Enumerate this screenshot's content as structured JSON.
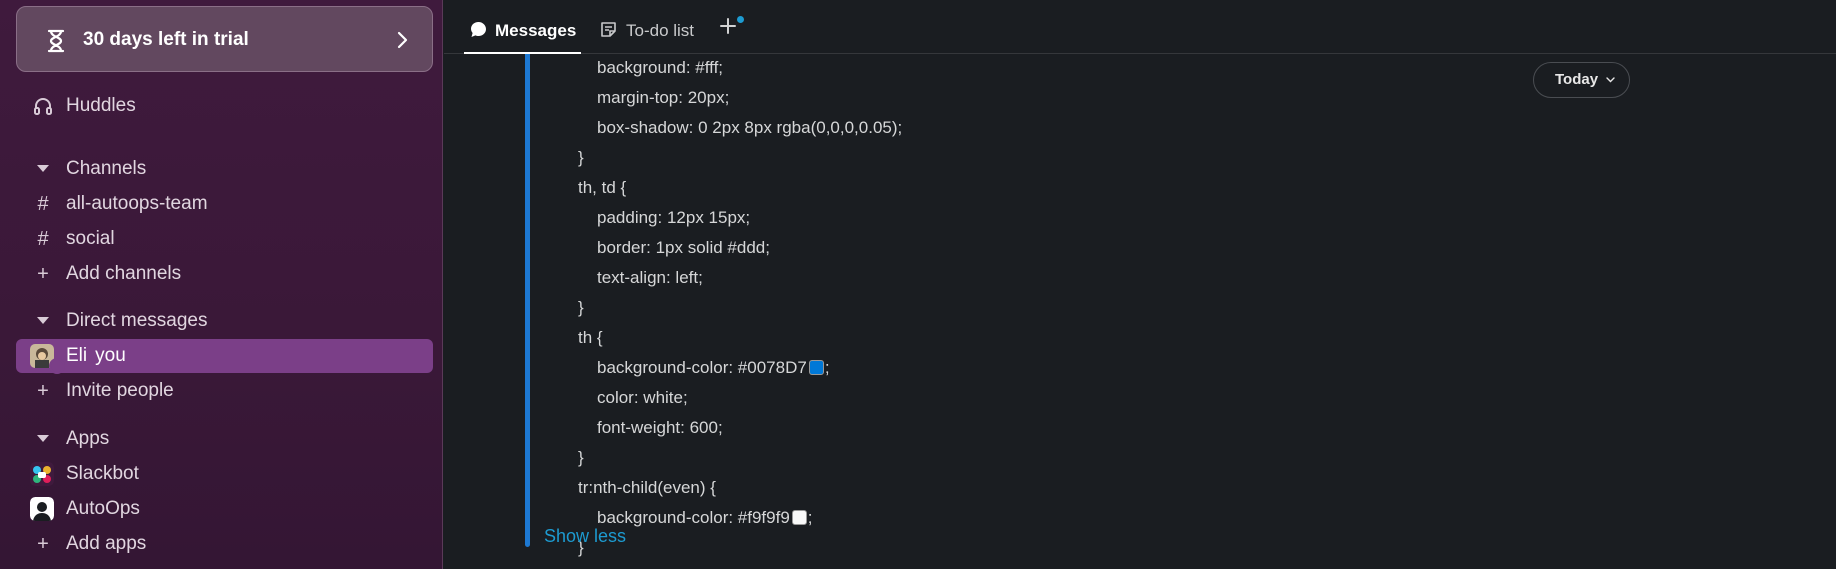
{
  "sidebar": {
    "trial_label": "30 days left in trial",
    "huddles_label": "Huddles",
    "channels_header": "Channels",
    "channels": [
      {
        "label": "all-autoops-team"
      },
      {
        "label": "social"
      }
    ],
    "add_channels_label": "Add channels",
    "dm_header": "Direct messages",
    "dm_user": "Eli",
    "dm_you": "you",
    "invite_label": "Invite people",
    "apps_header": "Apps",
    "apps": [
      {
        "label": "Slackbot"
      },
      {
        "label": "AutoOps"
      }
    ],
    "add_apps_label": "Add apps",
    "active_color": "#7b3f88"
  },
  "tabs": {
    "messages": "Messages",
    "todo": "To-do list"
  },
  "date_divider": "Today",
  "code": {
    "lines": [
      {
        "indent": 1,
        "text": "background: #fff;"
      },
      {
        "indent": 1,
        "text": "margin-top: 20px;"
      },
      {
        "indent": 1,
        "text": "box-shadow: 0 2px 8px rgba(0,0,0,0.05);"
      },
      {
        "indent": 0,
        "text": "}"
      },
      {
        "indent": 0,
        "text": "th, td {"
      },
      {
        "indent": 1,
        "text": "padding: 12px 15px;"
      },
      {
        "indent": 1,
        "text": "border: 1px solid #ddd;"
      },
      {
        "indent": 1,
        "text": "text-align: left;"
      },
      {
        "indent": 0,
        "text": "}"
      },
      {
        "indent": 0,
        "text": "th {"
      },
      {
        "indent": 1,
        "text": "background-color: #0078D7",
        "swatch": "#0078D7",
        "suffix": ";"
      },
      {
        "indent": 1,
        "text": "color: white;"
      },
      {
        "indent": 1,
        "text": "font-weight: 600;"
      },
      {
        "indent": 0,
        "text": "}"
      },
      {
        "indent": 0,
        "text": "tr:nth-child(even) {"
      },
      {
        "indent": 1,
        "text": "background-color: #f9f9f9",
        "swatch": "#f9f9f9",
        "suffix": ";"
      },
      {
        "indent": 0,
        "text": "}"
      }
    ],
    "show_less": "Show less"
  }
}
